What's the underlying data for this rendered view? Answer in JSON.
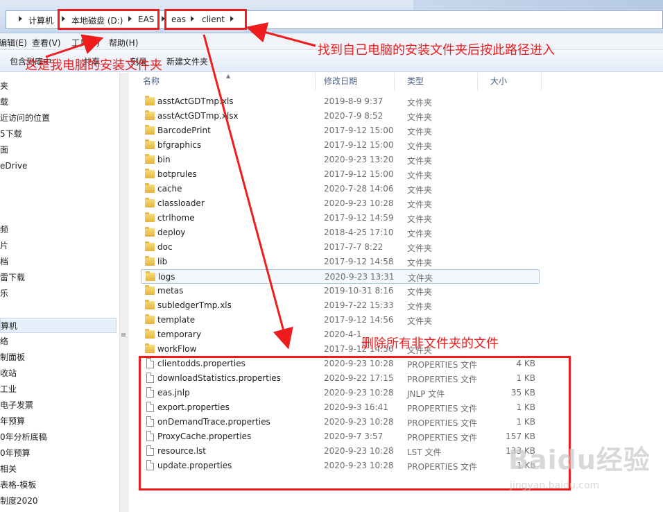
{
  "address": {
    "crumbs": [
      "计算机",
      "本地磁盘 (D:)",
      "EAS",
      "eas",
      "client"
    ]
  },
  "menu": {
    "items": [
      "编辑(E)",
      "查看(V)",
      "工具(T)",
      "帮助(H)"
    ]
  },
  "toolbar": {
    "items": [
      "包含到库中",
      "共享",
      "刻录",
      "新建文件夹"
    ]
  },
  "nav": {
    "items": [
      "夹",
      "载",
      "近访问的位置",
      "5下载",
      "面",
      "eDrive",
      "频",
      "片",
      "档",
      "雷下载",
      "乐",
      "算机",
      "络",
      "制面板",
      "收站",
      "工业",
      "电子发票",
      "年预算",
      "0年分析底稿",
      "0年预算",
      "相关",
      "表格-模板",
      "制度2020"
    ],
    "selected_index": 11,
    "scroll_glyph": "≡"
  },
  "columns": {
    "name": "名称",
    "date": "修改日期",
    "type": "类型",
    "size": "大小",
    "sort_glyph": "▲"
  },
  "files": [
    {
      "name": "asstActGDTmp.xls",
      "date": "2019-8-9 9:37",
      "type": "文件夹",
      "size": "",
      "kind": "folder"
    },
    {
      "name": "asstActGDTmp.xlsx",
      "date": "2020-7-9 8:52",
      "type": "文件夹",
      "size": "",
      "kind": "folder"
    },
    {
      "name": "BarcodePrint",
      "date": "2017-9-12 15:00",
      "type": "文件夹",
      "size": "",
      "kind": "folder"
    },
    {
      "name": "bfgraphics",
      "date": "2017-9-12 15:00",
      "type": "文件夹",
      "size": "",
      "kind": "folder"
    },
    {
      "name": "bin",
      "date": "2020-9-23 13:20",
      "type": "文件夹",
      "size": "",
      "kind": "folder"
    },
    {
      "name": "botprules",
      "date": "2017-9-12 15:00",
      "type": "文件夹",
      "size": "",
      "kind": "folder"
    },
    {
      "name": "cache",
      "date": "2020-7-28 14:06",
      "type": "文件夹",
      "size": "",
      "kind": "folder"
    },
    {
      "name": "classloader",
      "date": "2020-9-23 10:28",
      "type": "文件夹",
      "size": "",
      "kind": "folder"
    },
    {
      "name": "ctrlhome",
      "date": "2017-9-12 14:59",
      "type": "文件夹",
      "size": "",
      "kind": "folder"
    },
    {
      "name": "deploy",
      "date": "2018-4-25 17:10",
      "type": "文件夹",
      "size": "",
      "kind": "folder"
    },
    {
      "name": "doc",
      "date": "2017-7-7 8:22",
      "type": "文件夹",
      "size": "",
      "kind": "folder"
    },
    {
      "name": "lib",
      "date": "2017-9-12 14:58",
      "type": "文件夹",
      "size": "",
      "kind": "folder"
    },
    {
      "name": "logs",
      "date": "2020-9-23 13:31",
      "type": "文件夹",
      "size": "",
      "kind": "folder"
    },
    {
      "name": "metas",
      "date": "2019-10-31 8:16",
      "type": "文件夹",
      "size": "",
      "kind": "folder"
    },
    {
      "name": "subledgerTmp.xls",
      "date": "2019-7-22 15:33",
      "type": "文件夹",
      "size": "",
      "kind": "folder"
    },
    {
      "name": "template",
      "date": "2017-9-12 14:56",
      "type": "文件夹",
      "size": "",
      "kind": "folder"
    },
    {
      "name": "temporary",
      "date": "2020-4-1",
      "type": "",
      "size": "",
      "kind": "folder"
    },
    {
      "name": "workFlow",
      "date": "2017-9-12 14:56",
      "type": "文件夹",
      "size": "",
      "kind": "folder"
    },
    {
      "name": "clientodds.properties",
      "date": "2020-9-23 10:28",
      "type": "PROPERTIES 文件",
      "size": "4 KB",
      "kind": "file"
    },
    {
      "name": "downloadStatistics.properties",
      "date": "2020-9-22 17:15",
      "type": "PROPERTIES 文件",
      "size": "1 KB",
      "kind": "file"
    },
    {
      "name": "eas.jnlp",
      "date": "2020-9-23 10:28",
      "type": "JNLP 文件",
      "size": "35 KB",
      "kind": "file"
    },
    {
      "name": "export.properties",
      "date": "2020-9-3 16:41",
      "type": "PROPERTIES 文件",
      "size": "1 KB",
      "kind": "file"
    },
    {
      "name": "onDemandTrace.properties",
      "date": "2020-9-23 10:28",
      "type": "PROPERTIES 文件",
      "size": "1 KB",
      "kind": "file"
    },
    {
      "name": "ProxyCache.properties",
      "date": "2020-9-7 3:57",
      "type": "PROPERTIES 文件",
      "size": "157 KB",
      "kind": "file"
    },
    {
      "name": "resource.lst",
      "date": "2020-9-23 10:28",
      "type": "LST 文件",
      "size": "133 KB",
      "kind": "file"
    },
    {
      "name": "update.properties",
      "date": "2020-9-23 10:28",
      "type": "PROPERTIES 文件",
      "size": "1 Kb",
      "kind": "file"
    }
  ],
  "hover_index": 12,
  "annotations": {
    "path_note": "找到自己电脑的安装文件夹后按此路径进入",
    "install_note": "这是我电脑的安装文件夹",
    "delete_note": "删除所有非文件夹的文件",
    "color": "#ee1c1c"
  },
  "watermark": {
    "logo": "Baidu经验",
    "url": "jingyan.baidu.com"
  }
}
